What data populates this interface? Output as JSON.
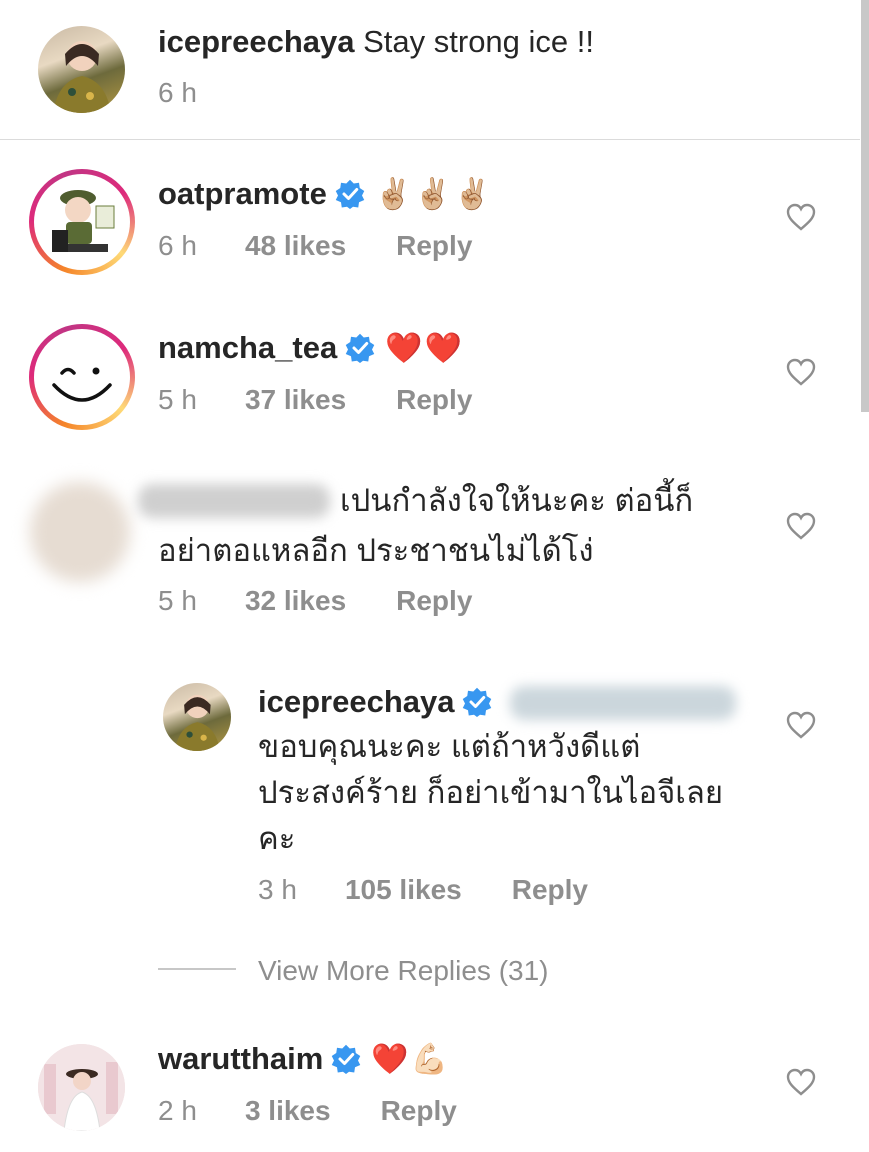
{
  "caption": {
    "username": "icepreechaya",
    "text": "Stay strong ice !!",
    "time": "6 h"
  },
  "comments": [
    {
      "username": "oatpramote",
      "verified": true,
      "emoji": "✌🏼✌🏼✌🏼",
      "time": "6 h",
      "likes": "48 likes",
      "reply": "Reply"
    },
    {
      "username": "namcha_tea",
      "verified": true,
      "emoji": "❤️❤️",
      "time": "5 h",
      "likes": "37 likes",
      "reply": "Reply"
    },
    {
      "text_line1": "เปนกำลังใจให้นะคะ ต่อนี้ก็",
      "text_line2": "อย่าตอแหลอีก ประชาชนไม่ได้โง่",
      "time": "5 h",
      "likes": "32 likes",
      "reply": "Reply"
    },
    {
      "username": "warutthaim",
      "verified": true,
      "emoji": "❤️💪🏻",
      "time": "2 h",
      "likes": "3 likes",
      "reply": "Reply"
    }
  ],
  "reply": {
    "username": "icepreechaya",
    "verified": true,
    "text_line1": "ขอบคุณนะคะ แต่ถ้าหวังดีแต่",
    "text_line2": "ประสงค์ร้าย ก็อย่าเข้ามาในไอจีเลย",
    "text_line3": "คะ",
    "time": "3 h",
    "likes": "105 likes",
    "reply": "Reply"
  },
  "view_more": "View More Replies (31)",
  "colors": {
    "text": "#262626",
    "muted": "#8e8e8e",
    "verified": "#3897f0",
    "divider": "#dbdbdb"
  }
}
